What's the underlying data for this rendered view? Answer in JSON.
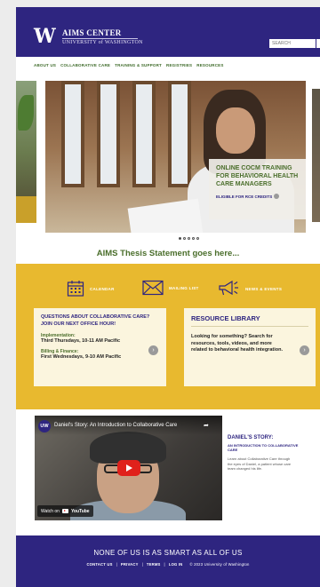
{
  "header": {
    "logo_mark": "W",
    "title": "AIMS CENTER",
    "subtitle": "UNIVERSITY of WASHINGTON",
    "search_placeholder": "SEARCH"
  },
  "nav": {
    "items": [
      {
        "label": "ABOUT US"
      },
      {
        "label": "COLLABORATIVE CARE"
      },
      {
        "label": "TRAINING & SUPPORT"
      },
      {
        "label": "REGISTRIES"
      },
      {
        "label": "RESOURCES"
      }
    ]
  },
  "carousel": {
    "slide_title": "ONLINE COCM TRAINING FOR BEHAVIORAL HEALTH CARE MANAGERS",
    "slide_cta": "ELIGIBLE FOR RCE CREDITS",
    "dot_count": 5,
    "active_dot": 0
  },
  "thesis": "AIMS Thesis Statement goes here...",
  "quick_links": {
    "calendar": "CALENDAR",
    "mailing": "MAILING LIST",
    "news": "NEWS & EVENTS"
  },
  "office_hours": {
    "heading": "QUESTIONS ABOUT COLLABORATIVE CARE? JOIN OUR NEXT OFFICE HOUR!",
    "impl_label": "Implementation:",
    "impl_time": "Third Thursdays, 10-11 AM Pacific",
    "billing_label": "Billing & Finance:",
    "billing_time": "First Wednesdays, 9-10 AM Pacific"
  },
  "library": {
    "heading": "RESOURCE LIBRARY",
    "body": "Looking for something? Search for resources, tools, videos, and more related to behavioral health integration."
  },
  "video": {
    "badge": "UW",
    "title": "Daniel's Story: An Introduction to Collaborative Care",
    "watch_on": "Watch on",
    "youtube": "YouTube"
  },
  "story": {
    "heading": "DANIEL'S STORY:",
    "subheading": "AN INTRODUCTION TO COLLABORATIVE CARE",
    "body": "Learn about Collaborative Care through the eyes of Daniel, a patient whose care team changed his life."
  },
  "footer": {
    "headline": "NONE OF US IS AS SMART AS ALL OF US",
    "links": [
      "CONTACT US",
      "PRIVACY",
      "TERMS",
      "LOG IN"
    ],
    "copyright": "© 2023 University of Washington"
  },
  "colors": {
    "brand_purple": "#2e2580",
    "accent_gold": "#e8b92f",
    "accent_green": "#4a6e2b"
  }
}
